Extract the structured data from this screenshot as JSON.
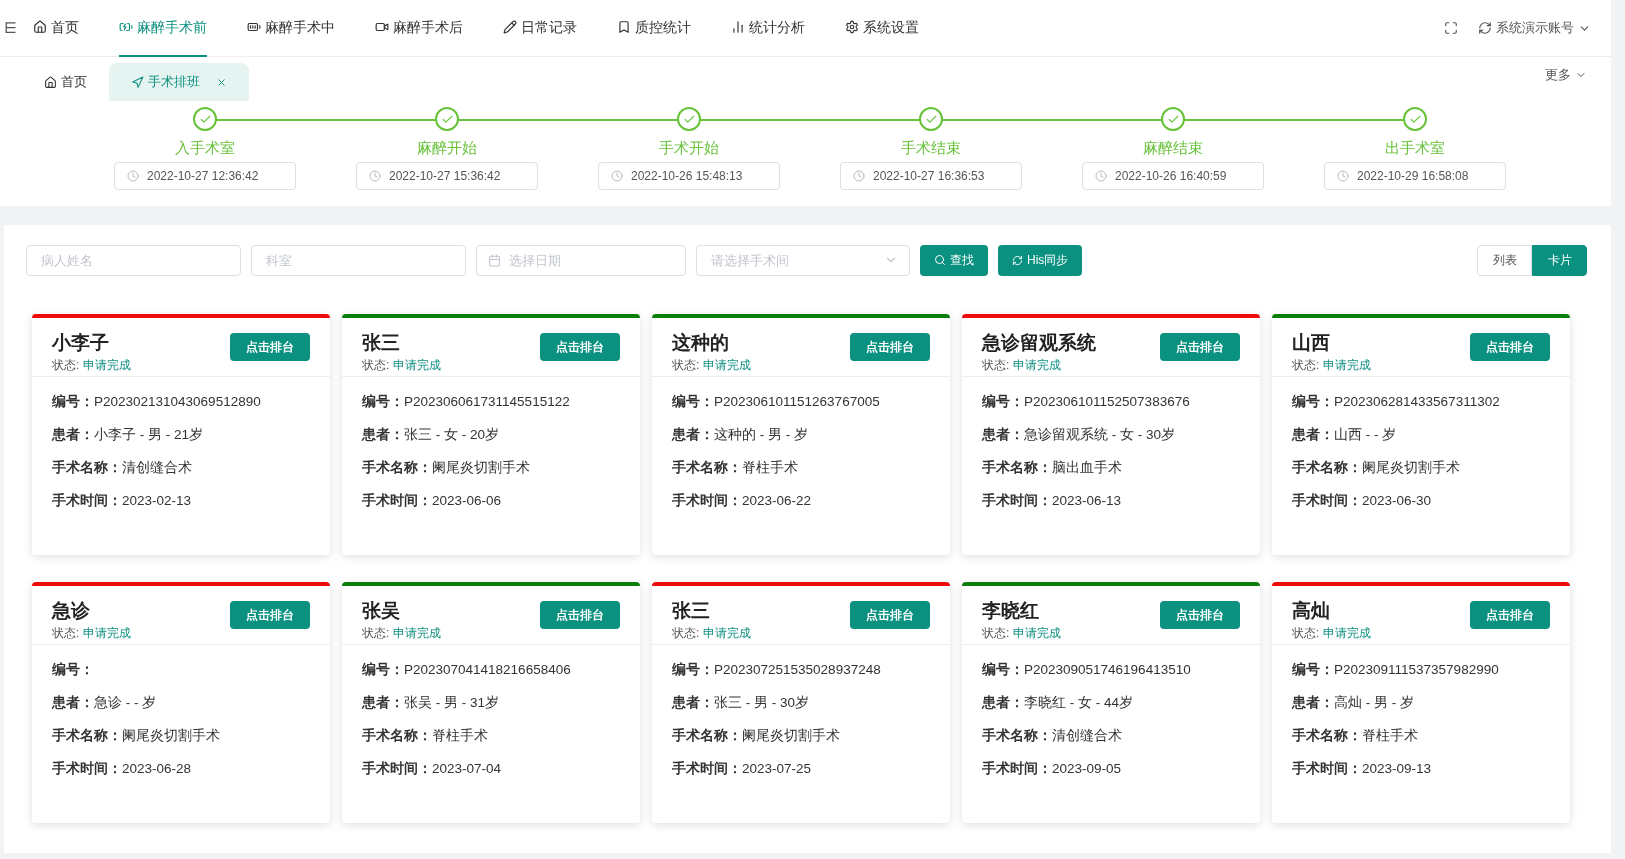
{
  "nav": {
    "collapse": "⋿",
    "items": [
      {
        "label": "首页",
        "selected": false
      },
      {
        "label": "麻醉手术前",
        "selected": true
      },
      {
        "label": "麻醉手术中",
        "selected": false
      },
      {
        "label": "麻醉手术后",
        "selected": false
      },
      {
        "label": "日常记录",
        "selected": false
      },
      {
        "label": "质控统计",
        "selected": false
      },
      {
        "label": "统计分析",
        "selected": false
      },
      {
        "label": "系统设置",
        "selected": false
      }
    ],
    "account": "系统演示账号"
  },
  "tabs": {
    "items": [
      {
        "label": "首页",
        "selected": false,
        "closable": false
      },
      {
        "label": "手术排班",
        "selected": true,
        "closable": true
      }
    ],
    "more": "更多"
  },
  "steps": [
    {
      "label": "入手术室",
      "done": true,
      "time": "2022-10-27 12:36:42"
    },
    {
      "label": "麻醉开始",
      "done": true,
      "time": "2022-10-27 15:36:42"
    },
    {
      "label": "手术开始",
      "done": true,
      "time": "2022-10-26 15:48:13"
    },
    {
      "label": "手术结束",
      "done": true,
      "time": "2022-10-27 16:36:53"
    },
    {
      "label": "麻醉结束",
      "done": true,
      "time": "2022-10-26 16:40:59"
    },
    {
      "label": "出手术室",
      "done": true,
      "time": "2022-10-29 16:58:08"
    }
  ],
  "filters": {
    "name": {
      "placeholder": "病人姓名"
    },
    "dept": {
      "placeholder": "科室"
    },
    "date": {
      "placeholder": "选择日期"
    },
    "room": {
      "placeholder": "请选择手术间"
    },
    "search": "查找",
    "sync": "His同步"
  },
  "view_toggle": [
    {
      "label": "列表",
      "selected": false
    },
    {
      "label": "卡片",
      "selected": true
    }
  ],
  "cards": [
    {
      "name": "小李子",
      "color": "#ee0a0a",
      "status_label": "状态:",
      "status": "申请完成",
      "button": "点击排台",
      "fields": [
        {
          "label": "编号：",
          "value": "P202302131043069512890"
        },
        {
          "label": "患者：",
          "value": "小李子 - 男 - 21岁"
        },
        {
          "label": "手术名称：",
          "value": "清创缝合术"
        },
        {
          "label": "手术时间：",
          "value": "2023-02-13"
        }
      ]
    },
    {
      "name": "张三",
      "color": "#0a7d0a",
      "status_label": "状态:",
      "status": "申请完成",
      "button": "点击排台",
      "fields": [
        {
          "label": "编号：",
          "value": "P202306061731145515122"
        },
        {
          "label": "患者：",
          "value": "张三 - 女 - 20岁"
        },
        {
          "label": "手术名称：",
          "value": "阑尾炎切割手术"
        },
        {
          "label": "手术时间：",
          "value": "2023-06-06"
        }
      ]
    },
    {
      "name": "这种的",
      "color": "#0a7d0a",
      "status_label": "状态:",
      "status": "申请完成",
      "button": "点击排台",
      "fields": [
        {
          "label": "编号：",
          "value": "P202306101151263767005"
        },
        {
          "label": "患者：",
          "value": "这种的 - 男 - 岁"
        },
        {
          "label": "手术名称：",
          "value": "脊柱手术"
        },
        {
          "label": "手术时间：",
          "value": "2023-06-22"
        }
      ]
    },
    {
      "name": "急诊留观系统",
      "color": "#ee0a0a",
      "status_label": "状态:",
      "status": "申请完成",
      "button": "点击排台",
      "fields": [
        {
          "label": "编号：",
          "value": "P202306101152507383676"
        },
        {
          "label": "患者：",
          "value": "急诊留观系统 - 女 - 30岁"
        },
        {
          "label": "手术名称：",
          "value": "脑出血手术"
        },
        {
          "label": "手术时间：",
          "value": "2023-06-13"
        }
      ]
    },
    {
      "name": "山西",
      "color": "#0a7d0a",
      "status_label": "状态:",
      "status": "申请完成",
      "button": "点击排台",
      "fields": [
        {
          "label": "编号：",
          "value": "P202306281433567311302"
        },
        {
          "label": "患者：",
          "value": "山西 - - 岁"
        },
        {
          "label": "手术名称：",
          "value": "阑尾炎切割手术"
        },
        {
          "label": "手术时间：",
          "value": "2023-06-30"
        }
      ]
    },
    {
      "name": "急诊",
      "color": "#ee0a0a",
      "status_label": "状态:",
      "status": "申请完成",
      "button": "点击排台",
      "fields": [
        {
          "label": "编号："
        },
        {
          "label": "患者：",
          "value": "急诊 - - 岁"
        },
        {
          "label": "手术名称：",
          "value": "阑尾炎切割手术"
        },
        {
          "label": "手术时间：",
          "value": "2023-06-28"
        }
      ]
    },
    {
      "name": "张吴",
      "color": "#0a7d0a",
      "status_label": "状态:",
      "status": "申请完成",
      "button": "点击排台",
      "fields": [
        {
          "label": "编号：",
          "value": "P202307041418216658406"
        },
        {
          "label": "患者：",
          "value": "张吴 - 男 - 31岁"
        },
        {
          "label": "手术名称：",
          "value": "脊柱手术"
        },
        {
          "label": "手术时间：",
          "value": "2023-07-04"
        }
      ]
    },
    {
      "name": "张三",
      "color": "#ee0a0a",
      "status_label": "状态:",
      "status": "申请完成",
      "button": "点击排台",
      "fields": [
        {
          "label": "编号：",
          "value": "P202307251535028937248"
        },
        {
          "label": "患者：",
          "value": "张三 - 男 - 30岁"
        },
        {
          "label": "手术名称：",
          "value": "阑尾炎切割手术"
        },
        {
          "label": "手术时间：",
          "value": "2023-07-25"
        }
      ]
    },
    {
      "name": "李晓红",
      "color": "#0a7d0a",
      "status_label": "状态:",
      "status": "申请完成",
      "button": "点击排台",
      "fields": [
        {
          "label": "编号：",
          "value": "P202309051746196413510"
        },
        {
          "label": "患者：",
          "value": "李晓红 - 女 - 44岁"
        },
        {
          "label": "手术名称：",
          "value": "清创缝合术"
        },
        {
          "label": "手术时间：",
          "value": "2023-09-05"
        }
      ]
    },
    {
      "name": "高灿",
      "color": "#ee0a0a",
      "status_label": "状态:",
      "status": "申请完成",
      "button": "点击排台",
      "fields": [
        {
          "label": "编号：",
          "value": "P202309111537357982990"
        },
        {
          "label": "患者：",
          "value": "高灿 - 男 - 岁"
        },
        {
          "label": "手术名称：",
          "value": "脊柱手术"
        },
        {
          "label": "手术时间：",
          "value": "2023-09-13"
        }
      ]
    }
  ]
}
